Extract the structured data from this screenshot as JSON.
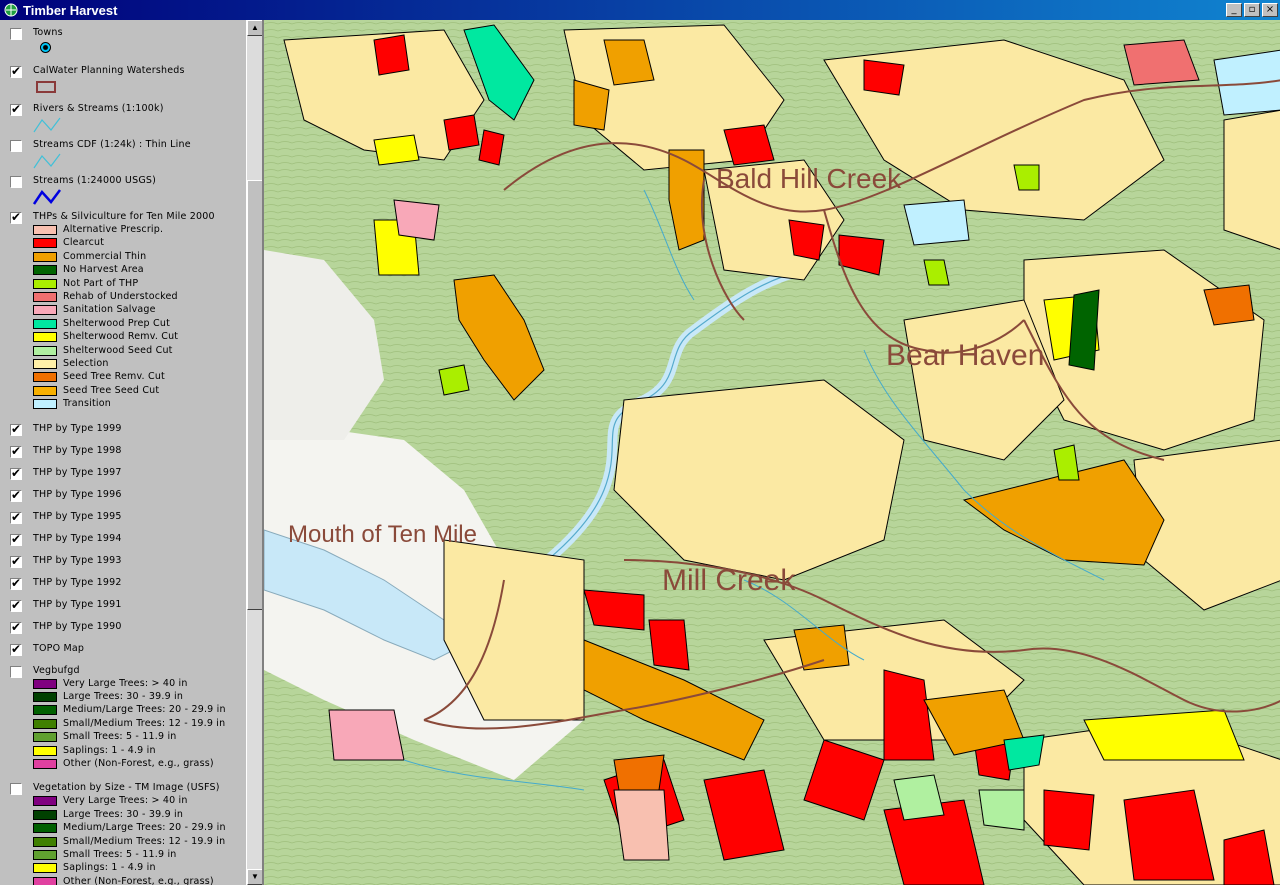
{
  "window": {
    "title": "Timber Harvest",
    "buttons": [
      "_",
      "▫",
      "×"
    ]
  },
  "legend": {
    "layers": [
      {
        "name": "Towns",
        "checked": false,
        "symbol": "dot"
      },
      {
        "name": "CalWater Planning Watersheds",
        "checked": true,
        "symbol": "box"
      },
      {
        "name": "Rivers & Streams (1:100k)",
        "checked": true,
        "symbol": "line-cyan"
      },
      {
        "name": "Streams CDF (1:24k) : Thin Line",
        "checked": false,
        "symbol": "line-cyan"
      },
      {
        "name": "Streams (1:24000 USGS)",
        "checked": false,
        "symbol": "line-blue"
      },
      {
        "name": "THPs & Silviculture for Ten Mile 2000",
        "checked": true,
        "classes": [
          {
            "label": "Alternative Prescrip.",
            "color": "#f8c0b0"
          },
          {
            "label": "Clearcut",
            "color": "#ff0000"
          },
          {
            "label": "Commercial Thin",
            "color": "#f0a000"
          },
          {
            "label": "No Harvest Area",
            "color": "#006400"
          },
          {
            "label": "Not Part of THP",
            "color": "#aaee00"
          },
          {
            "label": "Rehab of Understocked",
            "color": "#f07070"
          },
          {
            "label": "Sanitation Salvage",
            "color": "#f8a8b8"
          },
          {
            "label": "Shelterwood Prep Cut",
            "color": "#00e8a0"
          },
          {
            "label": "Shelterwood Remv. Cut",
            "color": "#ffff00"
          },
          {
            "label": "Shelterwood Seed Cut",
            "color": "#b0f0a0"
          },
          {
            "label": "Selection",
            "color": "#fff0a8"
          },
          {
            "label": "Seed Tree Remv. Cut",
            "color": "#f07000"
          },
          {
            "label": "Seed Tree Seed Cut",
            "color": "#f8b000"
          },
          {
            "label": "Transition",
            "color": "#c0f0ff"
          }
        ]
      },
      {
        "name": "THP by Type 1999",
        "checked": true
      },
      {
        "name": "THP by Type 1998",
        "checked": true
      },
      {
        "name": "THP by Type 1997",
        "checked": true
      },
      {
        "name": "THP by Type 1996",
        "checked": true
      },
      {
        "name": "THP by Type 1995",
        "checked": true
      },
      {
        "name": "THP by Type 1994",
        "checked": true
      },
      {
        "name": "THP by Type 1993",
        "checked": true
      },
      {
        "name": "THP by Type 1992",
        "checked": true
      },
      {
        "name": "THP by Type 1991",
        "checked": true
      },
      {
        "name": "THP by Type 1990",
        "checked": true
      },
      {
        "name": "TOPO Map",
        "checked": true
      },
      {
        "name": "Vegbufgd",
        "checked": false,
        "classes": [
          {
            "label": "Very Large Trees: > 40  in",
            "color": "#800080"
          },
          {
            "label": "Large Trees: 30 - 39.9 in",
            "color": "#004000"
          },
          {
            "label": "Medium/Large Trees: 20 - 29.9 in",
            "color": "#006000"
          },
          {
            "label": "Small/Medium Trees: 12 - 19.9 in",
            "color": "#408000"
          },
          {
            "label": "Small Trees: 5 - 11.9 in",
            "color": "#60a030"
          },
          {
            "label": "Saplings: 1 - 4.9 in",
            "color": "#ffff00"
          },
          {
            "label": "Other (Non-Forest, e.g., grass)",
            "color": "#e040a0"
          }
        ]
      },
      {
        "name": "Vegetation by Size - TM Image (USFS)",
        "checked": false,
        "classes": [
          {
            "label": "Very Large Trees: > 40  in",
            "color": "#800080"
          },
          {
            "label": "Large Trees: 30 - 39.9 in",
            "color": "#004000"
          },
          {
            "label": "Medium/Large Trees: 20 - 29.9 in",
            "color": "#006000"
          },
          {
            "label": "Small/Medium Trees: 12 - 19.9 in",
            "color": "#408000"
          },
          {
            "label": "Small Trees: 5 - 11.9 in",
            "color": "#60a030"
          },
          {
            "label": "Saplings: 1 - 4.9 in",
            "color": "#ffff00"
          },
          {
            "label": "Other (Non-Forest, e.g., grass)",
            "color": "#e040a0"
          }
        ]
      }
    ]
  },
  "map": {
    "labels": [
      "Bald Hill Creek",
      "Bear Haven",
      "Mouth of Ten Mile",
      "Mill Creek"
    ]
  }
}
